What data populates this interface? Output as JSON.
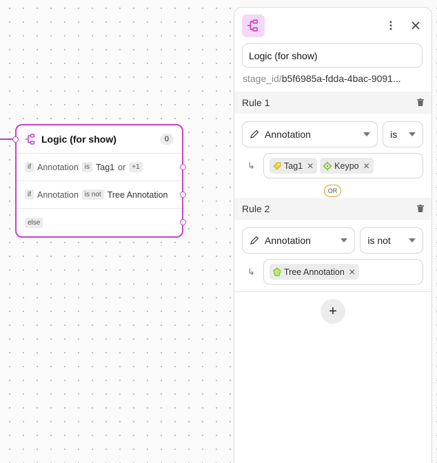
{
  "node": {
    "title": "Logic (for show)",
    "count": "0",
    "rows": [
      {
        "if": "if",
        "field": "Annotation",
        "op": "is",
        "value": "Tag1",
        "or": "or",
        "more": "+1"
      },
      {
        "if": "if",
        "field": "Annotation",
        "op": "is not",
        "value": "Tree Annotation"
      },
      {
        "else": "else"
      }
    ]
  },
  "panel": {
    "title": "Logic (for show)",
    "stage_prefix": "stage_id/",
    "stage_id": "b5f6985a-fdda-4bac-9091...",
    "rules": [
      {
        "label": "Rule 1",
        "field": "Annotation",
        "op": "is",
        "arrow": "↳",
        "tags": [
          {
            "label": "Tag1",
            "icon": "tag-icon",
            "color": "#d8c21a"
          },
          {
            "label": "Keypo",
            "icon": "keypoint-icon",
            "color": "#7cc81c"
          }
        ]
      },
      {
        "label": "Rule 2",
        "field": "Annotation",
        "op": "is not",
        "arrow": "↳",
        "tags": [
          {
            "label": "Tree Annotation",
            "icon": "polygon-icon",
            "color": "#7cc81c"
          }
        ]
      }
    ],
    "or_label": "OR",
    "add_label": "+"
  },
  "colors": {
    "accent": "#c542c8",
    "accent_bg": "#f4d8f6",
    "or_border": "#d9a21b"
  }
}
